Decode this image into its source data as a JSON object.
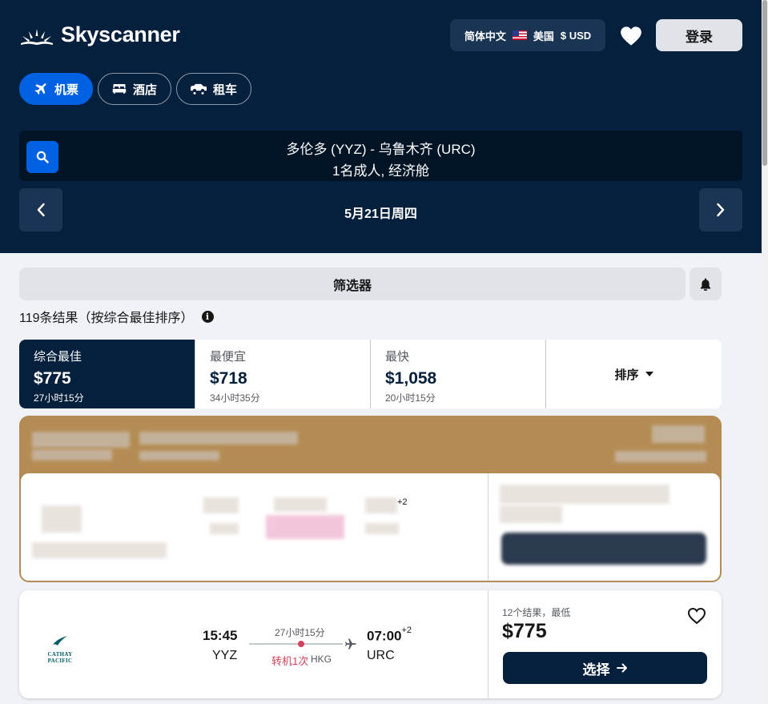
{
  "brand": {
    "name": "Skyscanner"
  },
  "header": {
    "language": "简体中文",
    "region": "美国",
    "currency": "$ USD",
    "login_label": "登录"
  },
  "tabs": [
    {
      "label": "机票",
      "icon": "plane-icon",
      "active": true
    },
    {
      "label": "酒店",
      "icon": "bed-icon",
      "active": false
    },
    {
      "label": "租车",
      "icon": "car-icon",
      "active": false
    }
  ],
  "search": {
    "route": "多伦多 (YYZ) - 乌鲁木齐 (URC)",
    "travellers": "1名成人, 经济舱",
    "date": "5月21日周四"
  },
  "filters": {
    "filter_label": "筛选器",
    "results_text": "119条结果（按综合最佳排序）",
    "info_glyph": "i"
  },
  "sort_tabs": [
    {
      "name": "综合最佳",
      "price": "$775",
      "duration": "27小时15分",
      "active": true
    },
    {
      "name": "最便宜",
      "price": "$718",
      "duration": "34小时35分",
      "active": false
    },
    {
      "name": "最快",
      "price": "$1,058",
      "duration": "20小时15分",
      "active": false
    }
  ],
  "sort_dropdown": {
    "label": "排序"
  },
  "sponsored": {
    "arrival_offset": "+2"
  },
  "flight": {
    "airline": "CATHAY PACIFIC",
    "depart_time": "15:45",
    "depart_code": "YYZ",
    "duration": "27小时15分",
    "stops": "转机1次",
    "via": "HKG",
    "arrive_time": "07:00",
    "arrive_offset": "+2",
    "arrive_code": "URC",
    "deals": "12个结果，最低",
    "price": "$775",
    "select_label": "选择"
  },
  "colors": {
    "navy": "#05203c",
    "accent_blue": "#0062e3",
    "sponsored_gold": "#b48c53",
    "stop_red": "#d1435b",
    "cathay_teal": "#005d63"
  }
}
